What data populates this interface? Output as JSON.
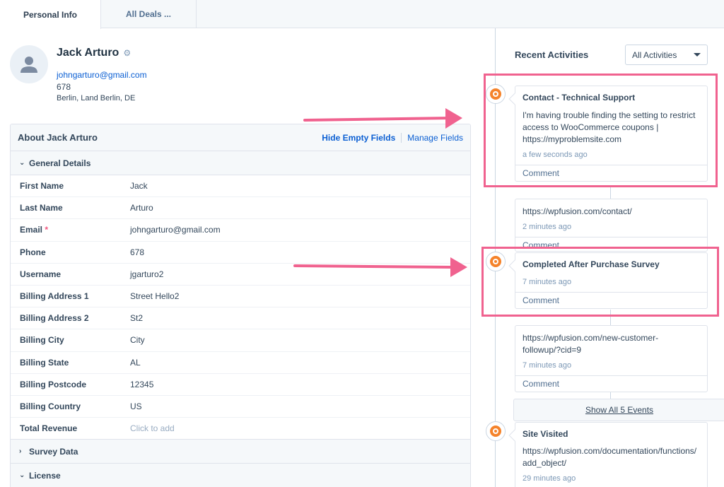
{
  "tabs": [
    {
      "label": "Personal Info",
      "active": true
    },
    {
      "label": "All Deals ...",
      "active": false
    }
  ],
  "profile": {
    "name": "Jack Arturo",
    "email": "johngarturo@gmail.com",
    "phone": "678",
    "location": "Berlin, Land Berlin, DE",
    "icons": {
      "avatar": "person-icon",
      "settings": "gear-icon"
    }
  },
  "about": {
    "title": "About Jack Arturo",
    "hide_empty_label": "Hide Empty Fields",
    "manage_fields_label": "Manage Fields",
    "sections": [
      {
        "label": "General Details",
        "expanded": true
      },
      {
        "label": "Survey Data",
        "expanded": false
      },
      {
        "label": "License",
        "expanded": true
      }
    ],
    "fields": [
      {
        "label": "First Name",
        "value": "Jack"
      },
      {
        "label": "Last Name",
        "value": "Arturo"
      },
      {
        "label": "Email",
        "value": "johngarturo@gmail.com",
        "required": true,
        "required_mark": "*"
      },
      {
        "label": "Phone",
        "value": "678"
      },
      {
        "label": "Username",
        "value": "jgarturo2"
      },
      {
        "label": "Billing Address 1",
        "value": "Street Hello2"
      },
      {
        "label": "Billing Address 2",
        "value": "St2"
      },
      {
        "label": "Billing City",
        "value": "City"
      },
      {
        "label": "Billing State",
        "value": "AL"
      },
      {
        "label": "Billing Postcode",
        "value": "12345"
      },
      {
        "label": "Billing Country",
        "value": "US"
      },
      {
        "label": "Total Revenue",
        "value": "",
        "placeholder": "Click to add"
      }
    ]
  },
  "activities": {
    "title": "Recent Activities",
    "filter": {
      "selected": "All Activities"
    },
    "comment_label": "Comment",
    "show_all_label": "Show All 5 Events",
    "items": [
      {
        "title": "Contact - Technical Support",
        "body": "I'm having trouble finding the setting to restrict access to WooCommerce coupons | https://myproblemsite.com",
        "time": "a few seconds ago"
      },
      {
        "body": "https://wpfusion.com/contact/",
        "time": "2 minutes ago"
      },
      {
        "title": "Completed After Purchase Survey",
        "time": "7 minutes ago"
      },
      {
        "body": "https://wpfusion.com/new-customer-followup/?cid=9",
        "time": "7 minutes ago"
      },
      {
        "title": "Site Visited",
        "body": "https://wpfusion.com/documentation/functions/add_object/",
        "time": "29 minutes ago"
      }
    ]
  },
  "colors": {
    "accent_link": "#0b5fd3",
    "timeline_icon": "#f5832b",
    "annotation": "#f0628f"
  }
}
